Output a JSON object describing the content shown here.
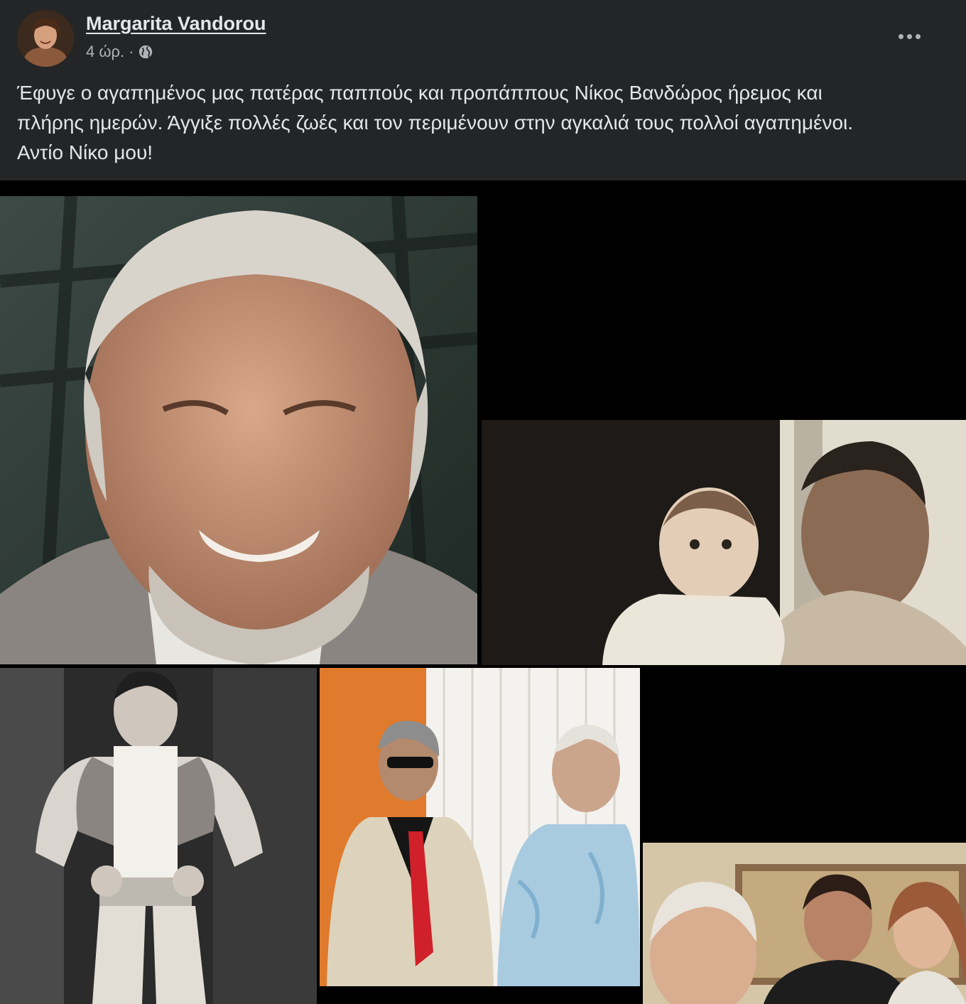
{
  "post": {
    "author": "Margarita Vandorou",
    "time": "4 ώρ.",
    "separator": "·",
    "privacy_icon": "globe-icon",
    "menu_icon": "more-horizontal-icon",
    "text_lines": [
      "Έφυγε ο αγαπημένος μας πατέρας παππούς και προπάππους Νίκος Βανδώρος ήρεμος και",
      "πλήρης ημερών. Άγγιξε πολλές ζωές και τον περιμένουν στην αγκαλιά τους πολλοί αγαπημένοι.",
      "Αντίο Νίκο μου!"
    ]
  },
  "colors": {
    "background": "#242526",
    "text_primary": "#e4e6eb",
    "text_secondary": "#b0b3b8",
    "photo_frame": "#000000"
  }
}
